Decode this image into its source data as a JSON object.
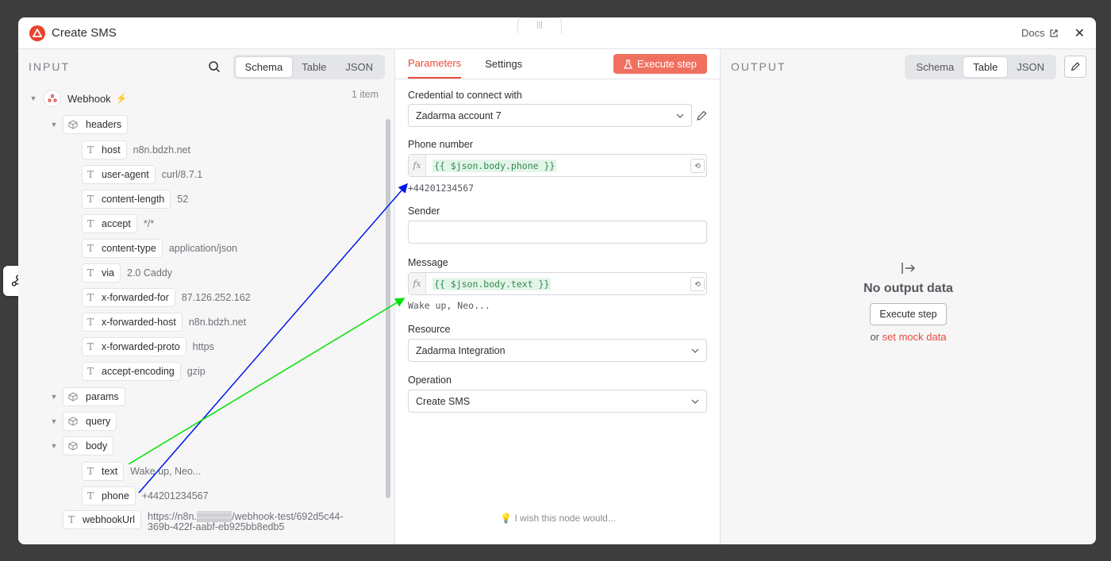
{
  "modal": {
    "title": "Create SMS",
    "docs_label": "Docs"
  },
  "input": {
    "label": "INPUT",
    "views": [
      "Schema",
      "Table",
      "JSON"
    ],
    "active_view": "Schema",
    "root": {
      "label": "Webhook",
      "count": "1 item"
    },
    "tree": {
      "headers": "headers",
      "host": {
        "key": "host",
        "value": "n8n.bdzh.net"
      },
      "user_agent": {
        "key": "user-agent",
        "value": "curl/8.7.1"
      },
      "content_length": {
        "key": "content-length",
        "value": "52"
      },
      "accept": {
        "key": "accept",
        "value": "*/*"
      },
      "content_type": {
        "key": "content-type",
        "value": "application/json"
      },
      "via": {
        "key": "via",
        "value": "2.0 Caddy"
      },
      "x_forwarded_for": {
        "key": "x-forwarded-for",
        "value": "87.126.252.162"
      },
      "x_forwarded_host": {
        "key": "x-forwarded-host",
        "value": "n8n.bdzh.net"
      },
      "x_forwarded_proto": {
        "key": "x-forwarded-proto",
        "value": "https"
      },
      "accept_encoding": {
        "key": "accept-encoding",
        "value": "gzip"
      },
      "params": "params",
      "query": "query",
      "body": "body",
      "text": {
        "key": "text",
        "value": "Wake up, Neo..."
      },
      "phone": {
        "key": "phone",
        "value": "+44201234567"
      },
      "webhook_url": {
        "key": "webhookUrl",
        "value_line1": "https://n8n.▒▒▒▒▒/webhook-test/692d5c44-",
        "value_line2": "369b-422f-aabf-eb925bb8edb5"
      }
    }
  },
  "params": {
    "tabs": [
      "Parameters",
      "Settings"
    ],
    "execute_label": "Execute step",
    "credential_label": "Credential to connect with",
    "credential_value": "Zadarma account 7",
    "phone_label": "Phone number",
    "phone_expr": "{{ $json.body.phone }}",
    "phone_hint": "+44201234567",
    "sender_label": "Sender",
    "sender_value": "",
    "message_label": "Message",
    "message_expr": "{{ $json.body.text }}",
    "message_hint": "Wake up, Neo...",
    "resource_label": "Resource",
    "resource_value": "Zadarma Integration",
    "operation_label": "Operation",
    "operation_value": "Create SMS",
    "wish_label": "I wish this node would..."
  },
  "output": {
    "label": "OUTPUT",
    "views": [
      "Schema",
      "Table",
      "JSON"
    ],
    "active_view": "Table",
    "empty_title": "No output data",
    "execute_label": "Execute step",
    "or_label": "or",
    "mock_label": "set mock data"
  },
  "colors": {
    "accent": "#ea4b3c",
    "arrow_phone": "#0018e8",
    "arrow_text": "#00e000"
  }
}
